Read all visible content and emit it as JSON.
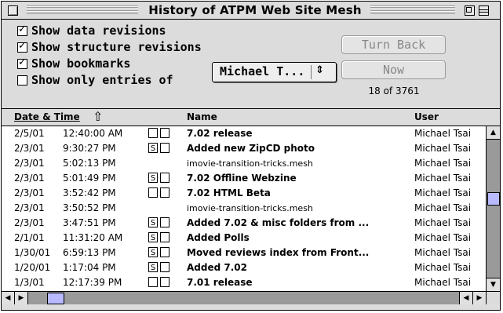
{
  "window": {
    "title": "History of ATPM Web Site Mesh"
  },
  "options": {
    "show_data_revisions": {
      "label": "Show data revisions",
      "checked": true
    },
    "show_structure_revisions": {
      "label": "Show structure revisions",
      "checked": true
    },
    "show_bookmarks": {
      "label": "Show bookmarks",
      "checked": true
    },
    "show_only_entries_of": {
      "label": "Show only entries of",
      "checked": false
    }
  },
  "user_filter": {
    "selected": "Michael T...",
    "arrow": "⇕"
  },
  "buttons": {
    "turn_back": "Turn Back",
    "now": "Now"
  },
  "count": "18 of 3761",
  "columns": {
    "date_time": "Date & Time",
    "sort_icon": "⇧",
    "name": "Name",
    "user": "User"
  },
  "rows": [
    {
      "date": "2/5/01",
      "time": "12:40:00 AM",
      "icon1": "",
      "icon2": "",
      "name": "7.02 release",
      "bold": true,
      "user": "Michael Tsai"
    },
    {
      "date": "2/3/01",
      "time": "9:30:27 PM",
      "icon1": "S",
      "icon2": "",
      "name": "Added new ZipCD photo",
      "bold": true,
      "user": "Michael Tsai"
    },
    {
      "date": "2/3/01",
      "time": "5:02:13 PM",
      "icon1": null,
      "icon2": null,
      "name": "imovie-transition-tricks.mesh",
      "bold": false,
      "user": "Michael Tsai"
    },
    {
      "date": "2/3/01",
      "time": "5:01:49 PM",
      "icon1": "S",
      "icon2": "",
      "name": "7.02 Offline Webzine",
      "bold": true,
      "user": "Michael Tsai"
    },
    {
      "date": "2/3/01",
      "time": "3:52:42 PM",
      "icon1": "",
      "icon2": "",
      "name": "7.02 HTML Beta",
      "bold": true,
      "user": "Michael Tsai"
    },
    {
      "date": "2/3/01",
      "time": "3:50:52 PM",
      "icon1": null,
      "icon2": null,
      "name": "imovie-transition-tricks.mesh",
      "bold": false,
      "user": "Michael Tsai"
    },
    {
      "date": "2/3/01",
      "time": "3:47:51 PM",
      "icon1": "S",
      "icon2": "",
      "name": "Added 7.02 & misc folders from ...",
      "bold": true,
      "user": "Michael Tsai"
    },
    {
      "date": "2/1/01",
      "time": "11:31:20 AM",
      "icon1": "S",
      "icon2": "",
      "name": "Added Polls",
      "bold": true,
      "user": "Michael Tsai"
    },
    {
      "date": "1/30/01",
      "time": "6:59:13 PM",
      "icon1": "S",
      "icon2": "",
      "name": "Moved reviews index from Front...",
      "bold": true,
      "user": "Michael Tsai"
    },
    {
      "date": "1/20/01",
      "time": "1:17:04 PM",
      "icon1": "S",
      "icon2": "",
      "name": "Added 7.02",
      "bold": true,
      "user": "Michael Tsai"
    },
    {
      "date": "1/3/01",
      "time": "12:17:39 PM",
      "icon1": "",
      "icon2": "",
      "name": "7.01 release",
      "bold": true,
      "user": "Michael Tsai"
    }
  ],
  "scrollbar": {
    "vertical_position": 0.42,
    "horizontal_position": 0.07
  }
}
